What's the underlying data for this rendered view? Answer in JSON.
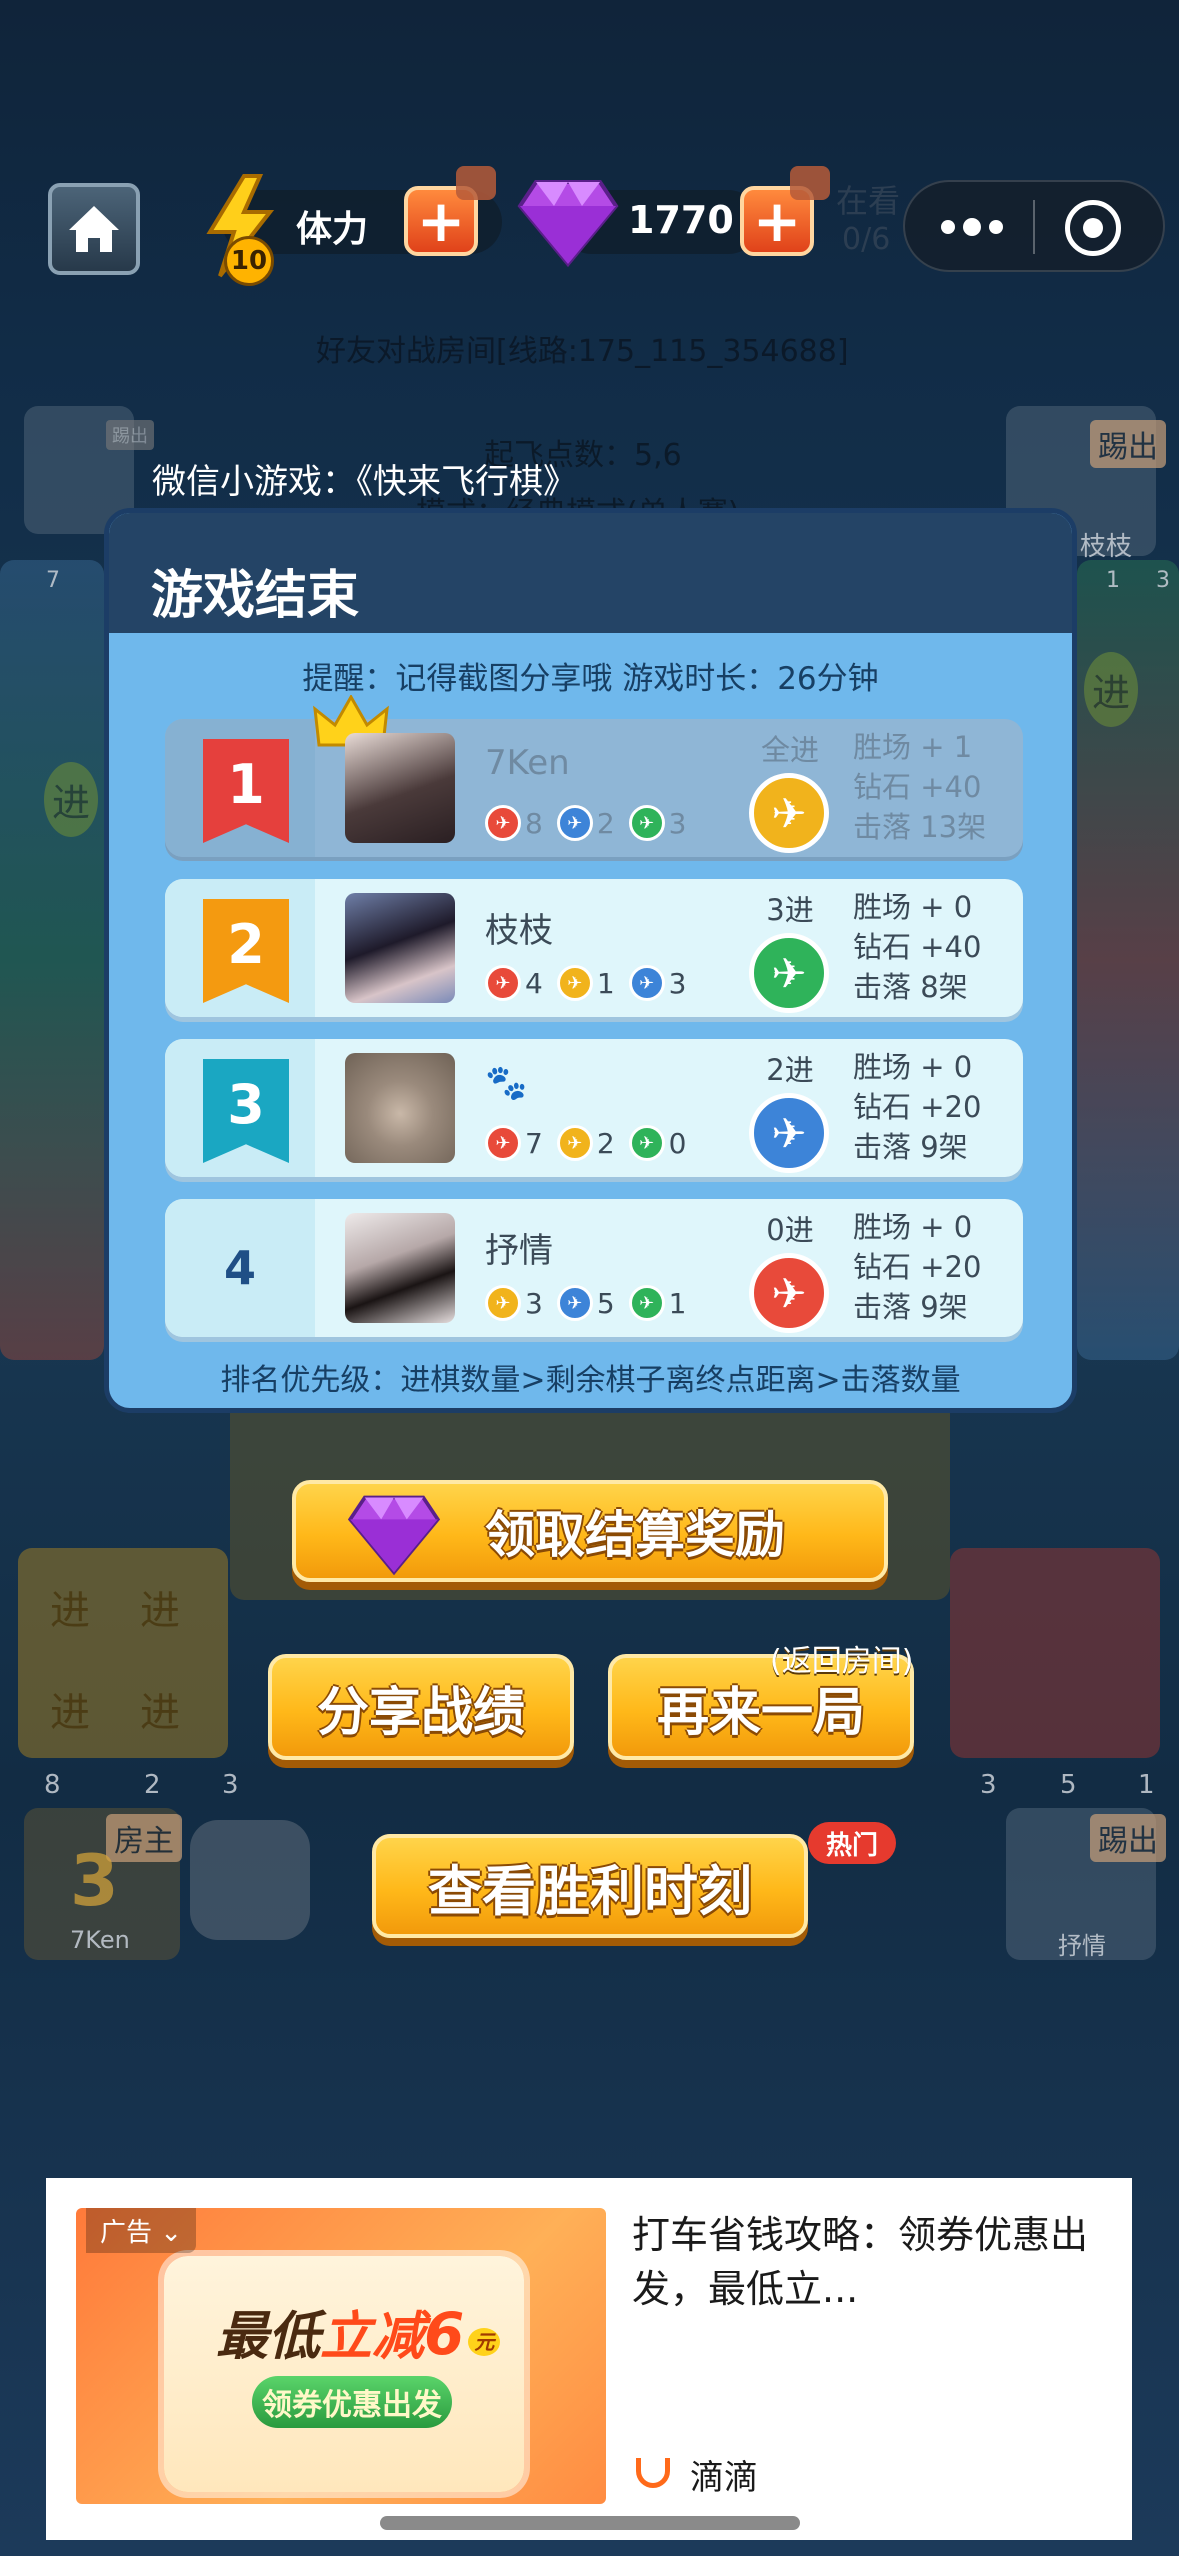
{
  "topbar": {
    "stamina_level": "10",
    "stamina_label": "体力",
    "diamond_count": "1770",
    "spectate_label": "在看",
    "spectate_count": "0/6"
  },
  "background": {
    "room_line": "好友对战房间[线路:175_115_354688]",
    "takeoff": "起飞点数：5,6",
    "mode": "模式：经典模式(单人赛)",
    "wechat_title": "微信小游戏：《快来飞行棋》",
    "kick": "踢出",
    "host": "房主",
    "player_left_name": "7Ken",
    "player_right_top_name": "枝枝",
    "player_right_bottom_name": "抒情",
    "enter_cell": "进",
    "dice_number": "3",
    "left_counts": [
      "8",
      "2",
      "3"
    ],
    "right_counts": [
      "3",
      "5",
      "1"
    ],
    "top_left_count": "7",
    "top_right_counts": [
      "1",
      "3"
    ]
  },
  "panel": {
    "title": "游戏结束",
    "reminder": "提醒：记得截图分享哦   游戏时长：26分钟",
    "footer": "排名优先级：进棋数量>剩余棋子离终点距离>击落数量",
    "rows": [
      {
        "rank": "1",
        "name": "7Ken",
        "counts": [
          "8",
          "2",
          "3"
        ],
        "entered": "全进",
        "wins": "胜场 + 1",
        "diamonds": "钻石 +40",
        "shot": "击落 13架"
      },
      {
        "rank": "2",
        "name": "枝枝",
        "counts": [
          "4",
          "1",
          "3"
        ],
        "entered": "3进",
        "wins": "胜场 + 0",
        "diamonds": "钻石 +40",
        "shot": "击落 8架"
      },
      {
        "rank": "3",
        "name": "🐾",
        "counts": [
          "7",
          "2",
          "0"
        ],
        "entered": "2进",
        "wins": "胜场 + 0",
        "diamonds": "钻石 +20",
        "shot": "击落 9架"
      },
      {
        "rank": "4",
        "name": "抒情",
        "counts": [
          "3",
          "5",
          "1"
        ],
        "entered": "0进",
        "wins": "胜场 + 0",
        "diamonds": "钻石 +20",
        "shot": "击落 9架"
      }
    ]
  },
  "buttons": {
    "claim": "领取结算奖励",
    "share": "分享战绩",
    "again": "再来一局",
    "again_note": "(返回房间)",
    "victory": "查看胜利时刻",
    "hot": "热门"
  },
  "ad": {
    "tag": "广告",
    "headline_prefix": "最低",
    "headline_main": "立减",
    "headline_num": "6",
    "headline_unit": "元",
    "coupon_sub": "领券优惠出发",
    "text": "打车省钱攻略：领券优惠出发，最低立...",
    "brand": "滴滴"
  },
  "colors": {
    "red": "#e84a3a",
    "blue": "#3d84d8",
    "green": "#2fb35a",
    "yellow": "#f1b31c",
    "rank1": "#e5403d",
    "rank2": "#f49a10",
    "rank3": "#1aa7c2"
  }
}
